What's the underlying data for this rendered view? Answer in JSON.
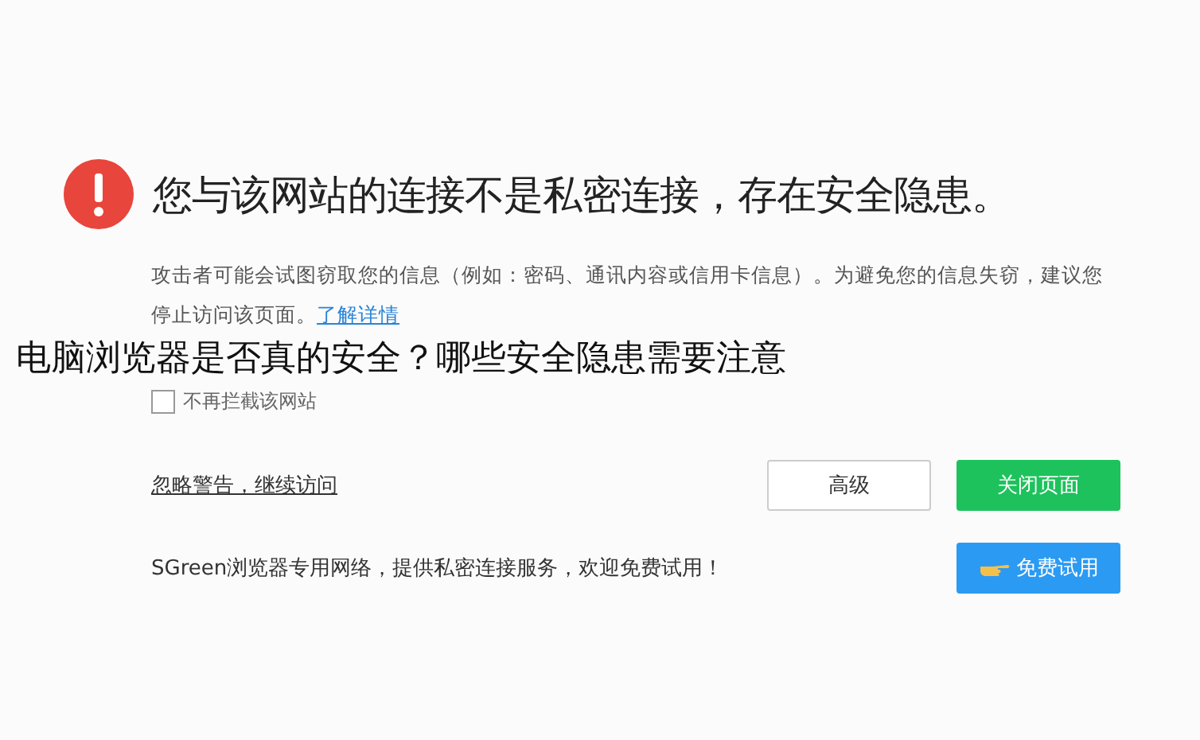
{
  "warning": {
    "title": "您与该网站的连接不是私密连接，存在安全隐患。",
    "description": "攻击者可能会试图窃取您的信息（例如：密码、通讯内容或信用卡信息）。为避免您的信息失窃，建议您停止访问该页面。",
    "learn_more_link": "了解详情"
  },
  "overlay_title": "电脑浏览器是否真的安全？哪些安全隐患需要注意",
  "checkbox": {
    "label": "不再拦截该网站",
    "checked": false
  },
  "ignore_link": "忽略警告，继续访问",
  "buttons": [
    {
      "label": "高级",
      "kind": "secondary"
    },
    {
      "label": "关闭页面",
      "kind": "primary"
    }
  ],
  "promo": {
    "text": "SGreen浏览器专用网络，提供私密连接服务，欢迎免费试用！",
    "button": "免费试用"
  }
}
